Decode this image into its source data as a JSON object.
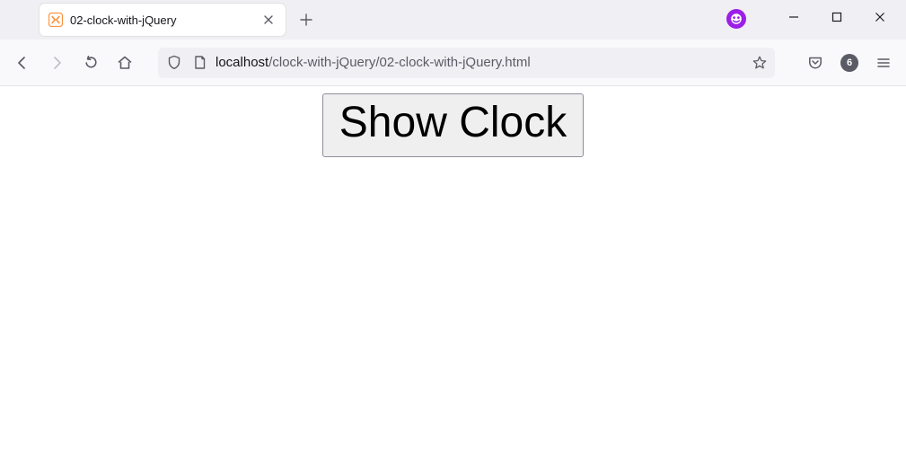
{
  "tab": {
    "title": "02-clock-with-jQuery"
  },
  "url": {
    "domain": "localhost",
    "path": "/clock-with-jQuery/02-clock-with-jQuery.html"
  },
  "toolbar": {
    "tab_count": "6"
  },
  "page": {
    "button_label": "Show Clock"
  }
}
